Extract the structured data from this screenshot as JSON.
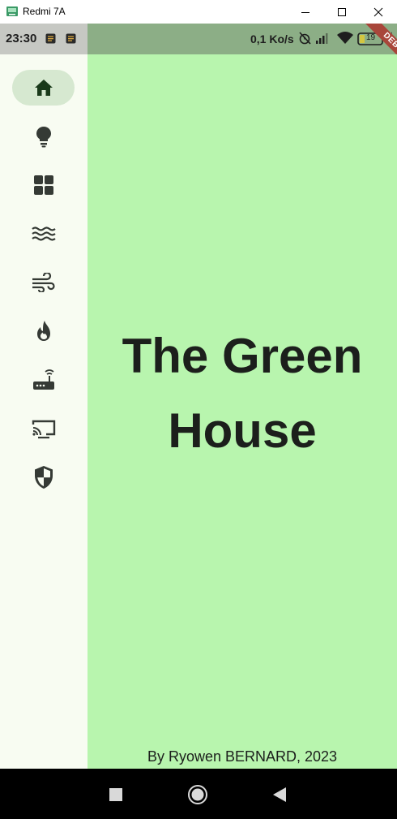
{
  "window": {
    "title": "Redmi 7A"
  },
  "status_bar": {
    "time": "23:30",
    "network_speed": "0,1 Ko/s",
    "battery_level": "19"
  },
  "debug_banner": {
    "label": "DEBUG"
  },
  "nav_rail": {
    "items": [
      {
        "icon": "home-icon",
        "active": true
      },
      {
        "icon": "lightbulb-icon",
        "active": false
      },
      {
        "icon": "grid-icon",
        "active": false
      },
      {
        "icon": "waves-icon",
        "active": false
      },
      {
        "icon": "air-icon",
        "active": false
      },
      {
        "icon": "fire-icon",
        "active": false
      },
      {
        "icon": "router-icon",
        "active": false
      },
      {
        "icon": "cast-icon",
        "active": false
      },
      {
        "icon": "shield-icon",
        "active": false
      }
    ]
  },
  "main": {
    "title_line1": "The Green",
    "title_line2": "House",
    "credit": "By Ryowen BERNARD, 2023"
  },
  "colors": {
    "rail_background": "#f8fcf2",
    "active_pill": "#d6e8d0",
    "main_background": "#b8f5ae",
    "status_bar_tint": "#8cae86",
    "debug_banner": "#a8463a"
  }
}
